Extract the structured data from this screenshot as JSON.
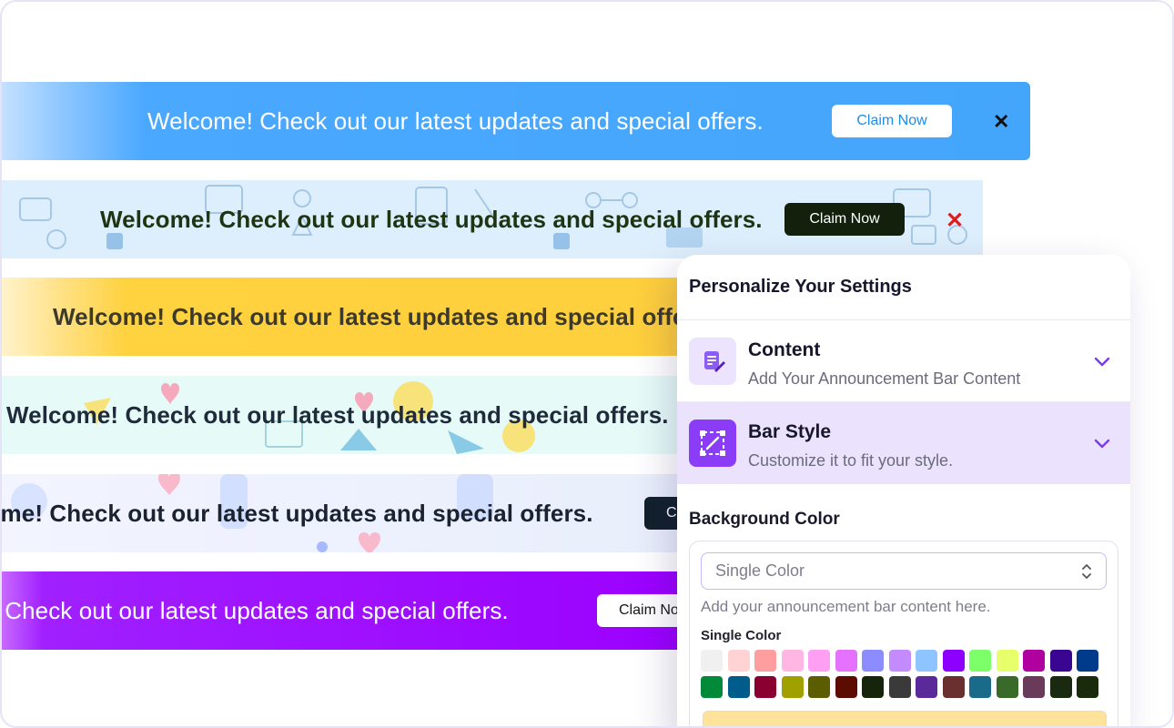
{
  "bars": {
    "message": "Welcome! Check out our latest updates and special offers.",
    "message_b5": "come! Check out our latest updates and special offers.",
    "message_b6": "e! Check out our latest updates and special offers.",
    "cta": "Claim Now",
    "cta_partial_b5": "C",
    "cta_partial_b6": "Claim No",
    "close_symbol": "✕"
  },
  "panel": {
    "title": "Personalize Your Settings",
    "sections": [
      {
        "title": "Content",
        "subtitle": "Add Your Announcement  Bar Content",
        "icon": "document-edit-icon"
      },
      {
        "title": "Bar Style",
        "subtitle": "Customize it to fit your style.",
        "icon": "layout-design-icon"
      }
    ],
    "background": {
      "heading": "Background Color",
      "select_value": "Single Color",
      "hint": "Add your announcement bar content here.",
      "swatch_label": "Single Color"
    }
  },
  "colors": {
    "swatches_row1": [
      "#f0f0f0",
      "#ffd3d3",
      "#ff9e9e",
      "#ffb6e3",
      "#ff9ff4",
      "#e472ff",
      "#8c8cff",
      "#c48aff",
      "#8ec4ff",
      "#8d00ff",
      "#7dff6a",
      "#e6ff6a",
      "#b000a0",
      "#3a0590",
      "#003a8a"
    ],
    "swatches_row2": [
      "#008a3a",
      "#005c8a",
      "#8a0030",
      "#a0a000",
      "#5c5c00",
      "#5c0c00",
      "#16240c",
      "#3a3a3a",
      "#5a2a9a",
      "#6a3030",
      "#1a6a8a",
      "#3a6a2a",
      "#6a3a5a",
      "#1a2a10",
      "#1a2a0c"
    ]
  }
}
